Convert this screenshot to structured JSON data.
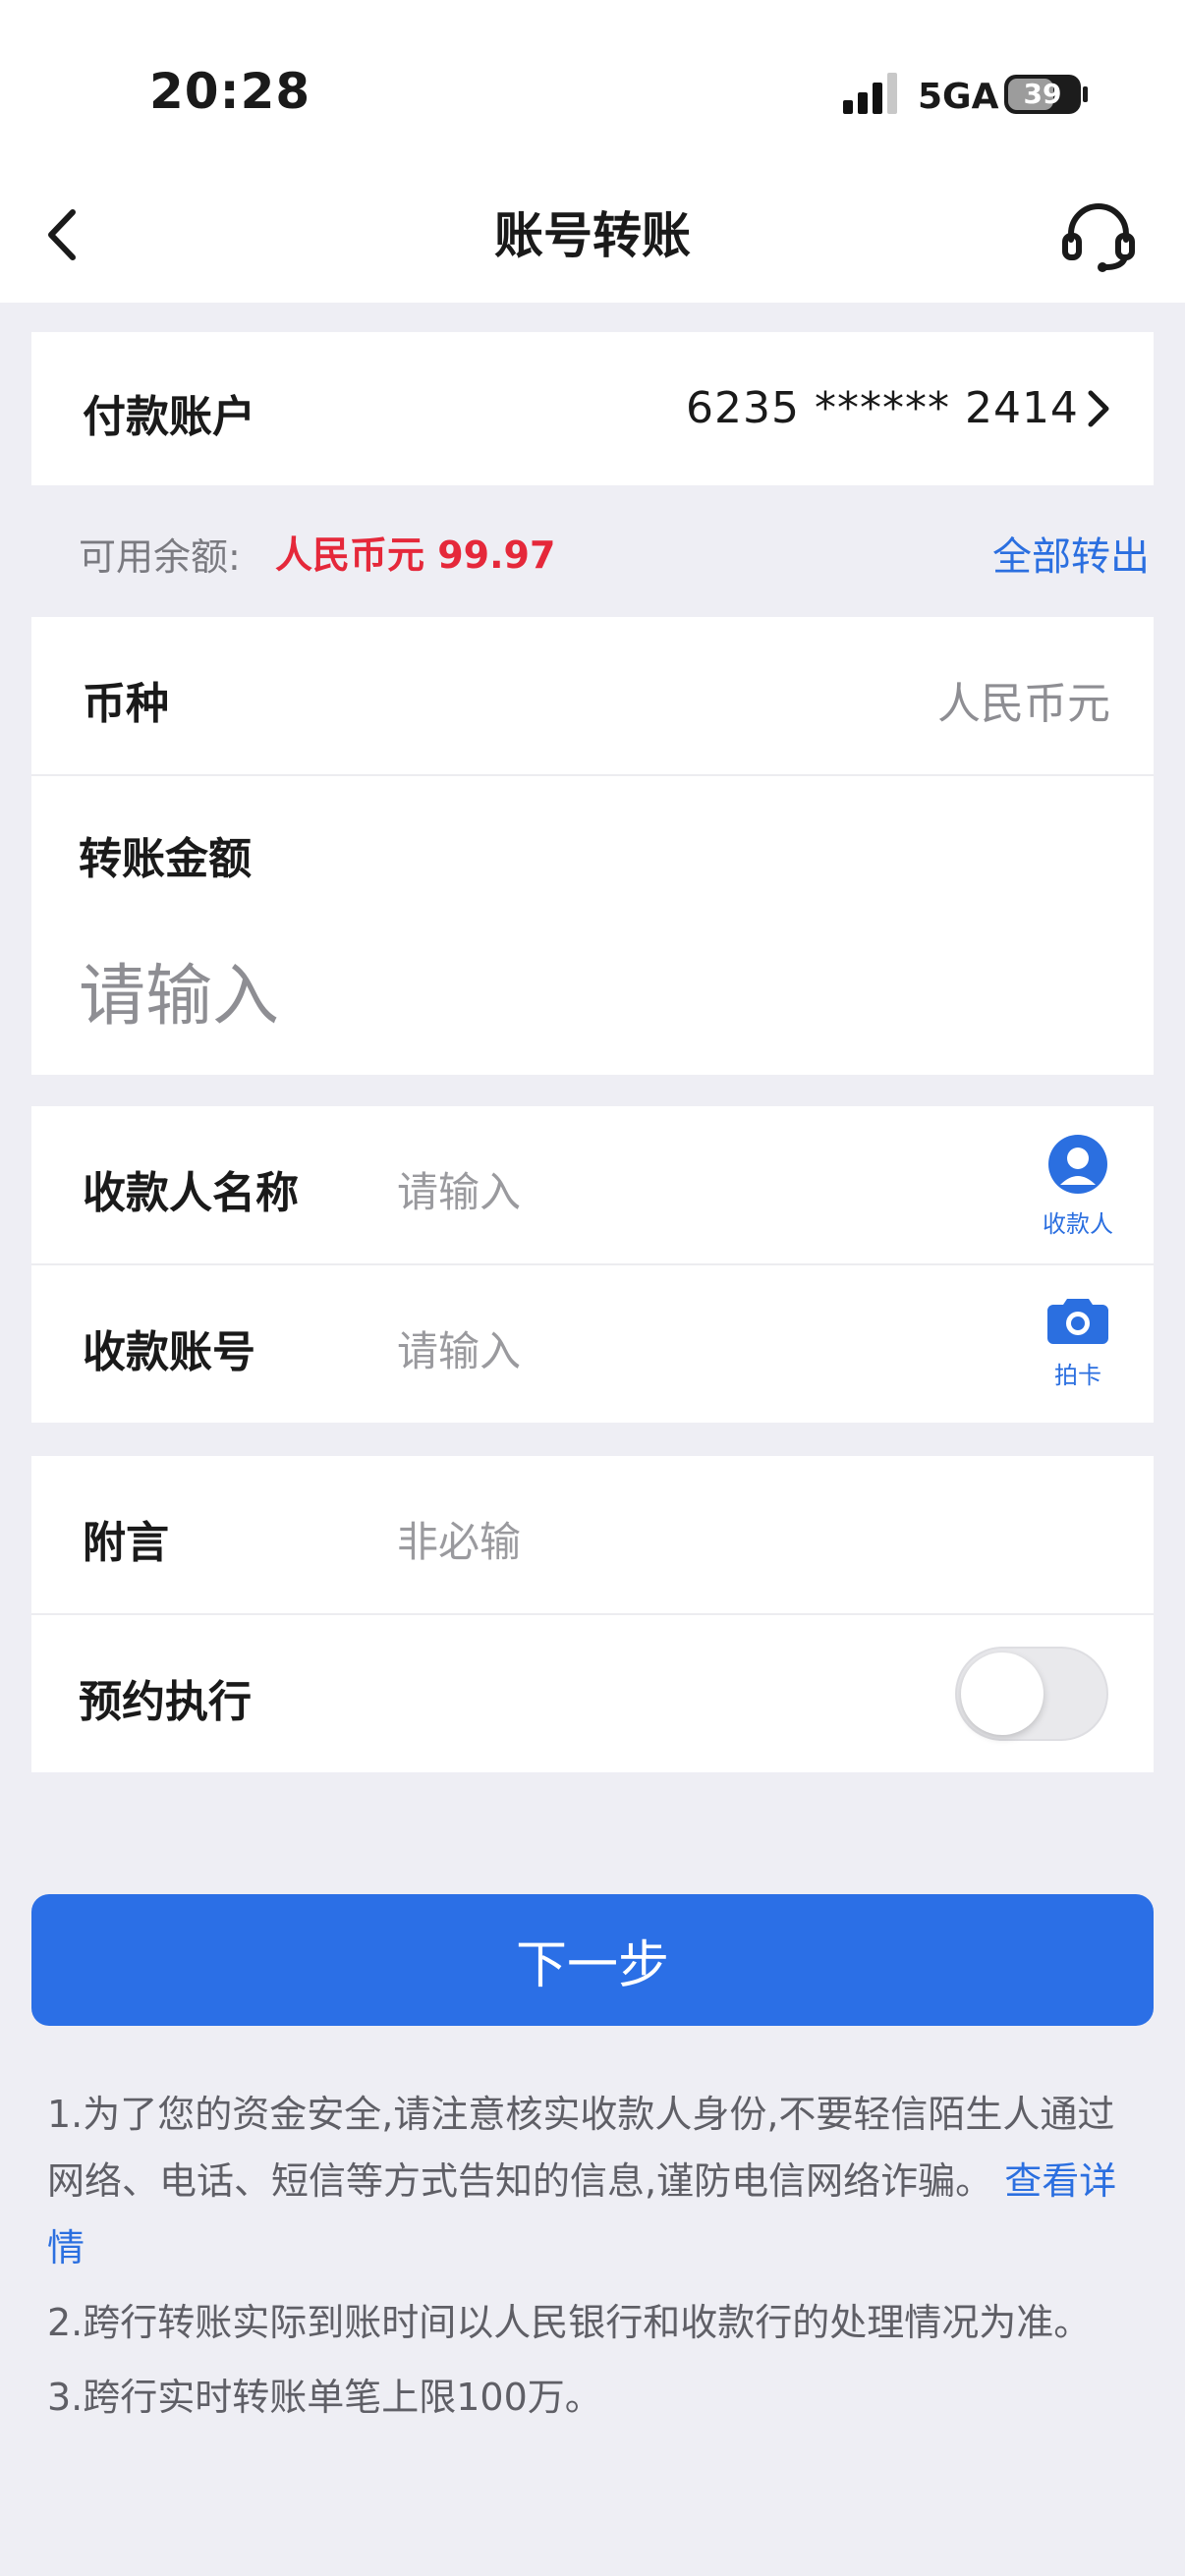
{
  "status_bar": {
    "time": "20:28",
    "network": "5GA",
    "battery": "39"
  },
  "nav": {
    "title": "账号转账",
    "back_icon": "chevron-left-icon",
    "service_icon": "headset-icon"
  },
  "payer": {
    "label": "付款账户",
    "account": "6235 ****** 2414"
  },
  "balance": {
    "label": "可用余额:",
    "value": "人民币元 99.97",
    "transfer_all": "全部转出"
  },
  "currency": {
    "label": "币种",
    "value": "人民币元"
  },
  "amount": {
    "label": "转账金额",
    "placeholder": "请输入"
  },
  "payee": {
    "name_label": "收款人名称",
    "name_placeholder": "请输入",
    "name_icon_label": "收款人",
    "account_label": "收款账号",
    "account_placeholder": "请输入",
    "account_icon_label": "拍卡"
  },
  "memo": {
    "label": "附言",
    "placeholder": "非必输"
  },
  "scheduled": {
    "label": "预约执行",
    "enabled": false
  },
  "next_button": "下一步",
  "notes": {
    "n1": "1.为了您的资金安全,请注意核实收款人身份,不要轻信陌生人通过网络、电话、短信等方式告知的信息,谨防电信网络诈骗。",
    "n1_link": "查看详情",
    "n2": "2.跨行转账实际到账时间以人民银行和收款行的处理情况为准。",
    "n3": "3.跨行实时转账单笔上限100万。"
  },
  "colors": {
    "accent": "#2b6fe6",
    "balance_red": "#e5283a"
  }
}
